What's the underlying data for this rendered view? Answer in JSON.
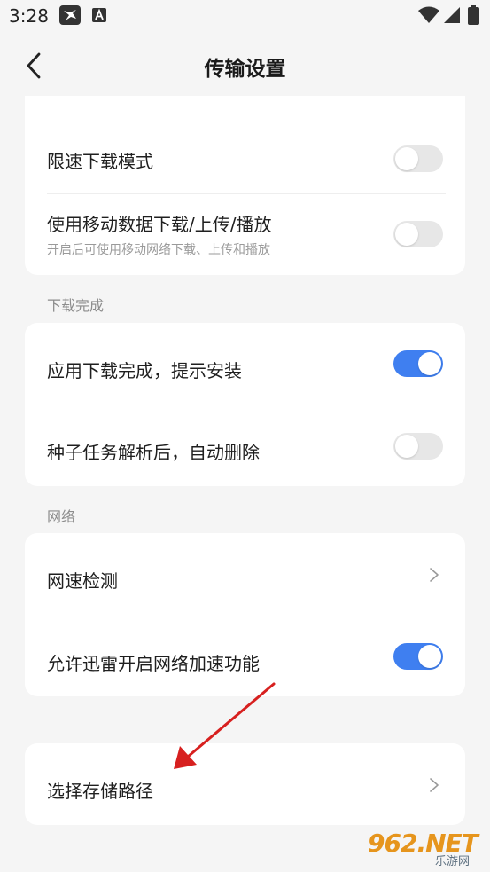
{
  "status_bar": {
    "time": "3:28",
    "icons": [
      "bird-notification-icon",
      "a-notification-icon",
      "wifi-icon",
      "signal-icon",
      "battery-icon"
    ]
  },
  "header": {
    "title": "传输设置",
    "back_icon": "back-arrow-icon"
  },
  "group1": {
    "rows": [
      {
        "label": "限速下载模式",
        "toggle": "off"
      },
      {
        "label": "使用移动数据下载/上传/播放",
        "subtitle": "开启后可使用移动网络下载、上传和播放",
        "toggle": "off"
      }
    ]
  },
  "group2": {
    "header": "下载完成",
    "rows": [
      {
        "label": "应用下载完成，提示安装",
        "toggle": "on"
      },
      {
        "label": "种子任务解析后，自动删除",
        "toggle": "off"
      }
    ]
  },
  "group3": {
    "header": "网络",
    "rows": [
      {
        "label": "网速检测",
        "action": "chevron-right-icon"
      },
      {
        "label": "允许迅雷开启网络加速功能",
        "toggle": "on"
      }
    ]
  },
  "group4": {
    "rows": [
      {
        "label": "选择存储路径",
        "action": "chevron-right-icon"
      }
    ]
  },
  "watermark": {
    "main": "962.NET",
    "sub": "乐游网"
  },
  "colors": {
    "accent": "#3f7ff0",
    "toggle_off": "#e7e7e7",
    "background": "#f5f5f5",
    "card": "#ffffff",
    "annotation_arrow": "#d7201f",
    "watermark": "#e6951d"
  }
}
